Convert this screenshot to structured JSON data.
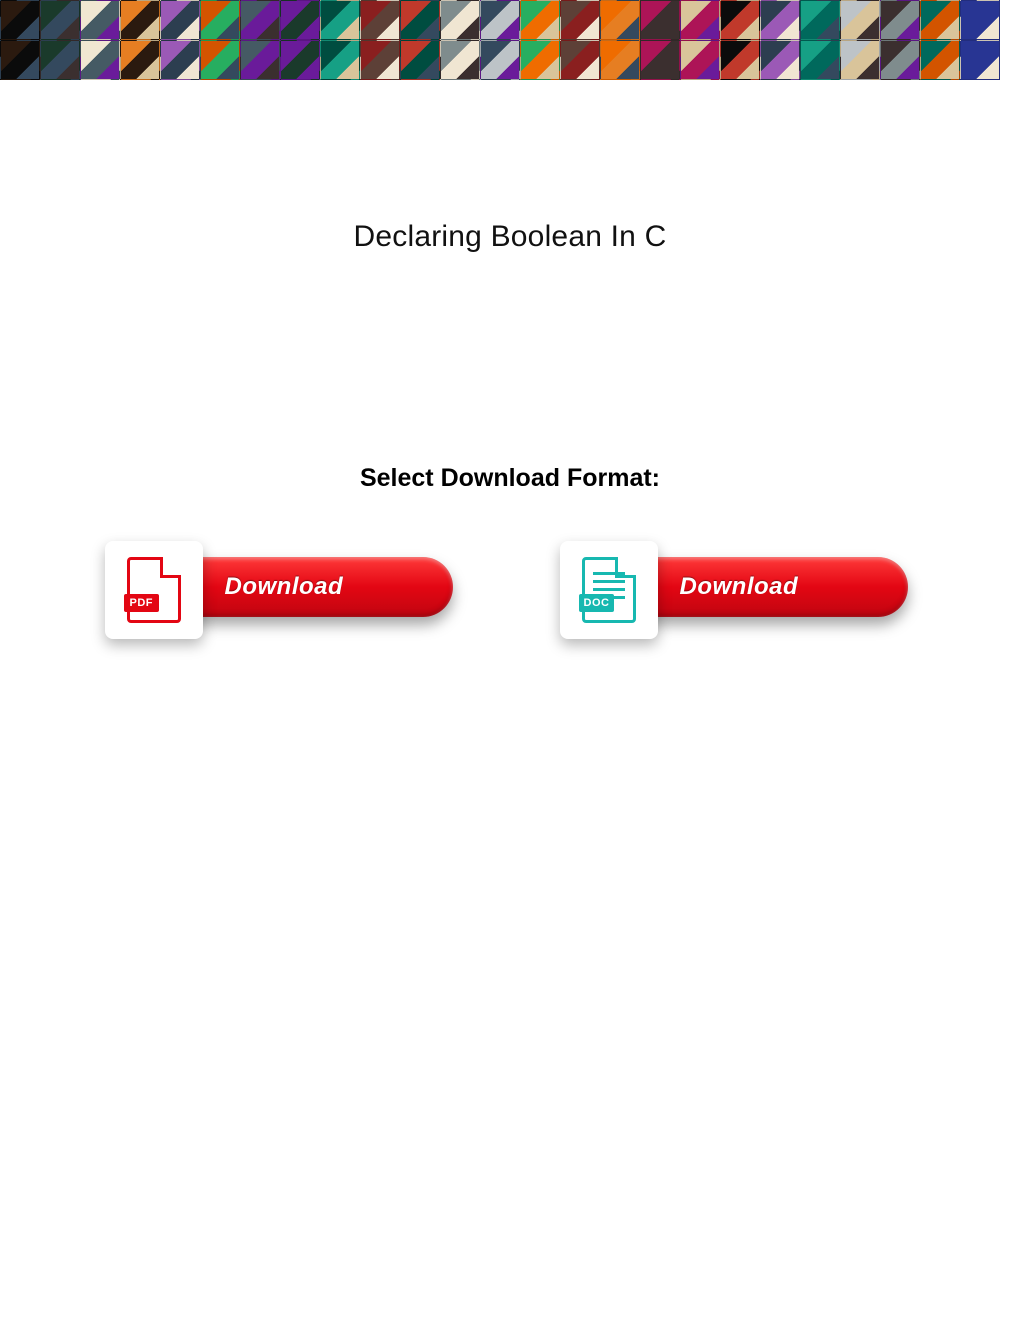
{
  "title": "Declaring Boolean In C",
  "select_label": "Select Download Format:",
  "downloads": {
    "pdf": {
      "button_label": "Download",
      "badge": "PDF"
    },
    "doc": {
      "button_label": "Download",
      "badge": "DOC"
    }
  },
  "banner": {
    "thumb_count": 50,
    "palette": [
      "#2b1a0f",
      "#d9c49a",
      "#8a1f1f",
      "#1a3a2b",
      "#0b0b0b",
      "#c0392b",
      "#f0e6d2",
      "#2c3e50",
      "#7f8c8d",
      "#e67e22",
      "#16a085",
      "#34495e",
      "#9b59b6",
      "#bdc3c7",
      "#27ae60",
      "#d35400",
      "#3b2f2f",
      "#5d4037",
      "#455a64",
      "#00695c",
      "#ef6c00",
      "#6a1b9a",
      "#283593",
      "#ad1457",
      "#004d40"
    ]
  }
}
